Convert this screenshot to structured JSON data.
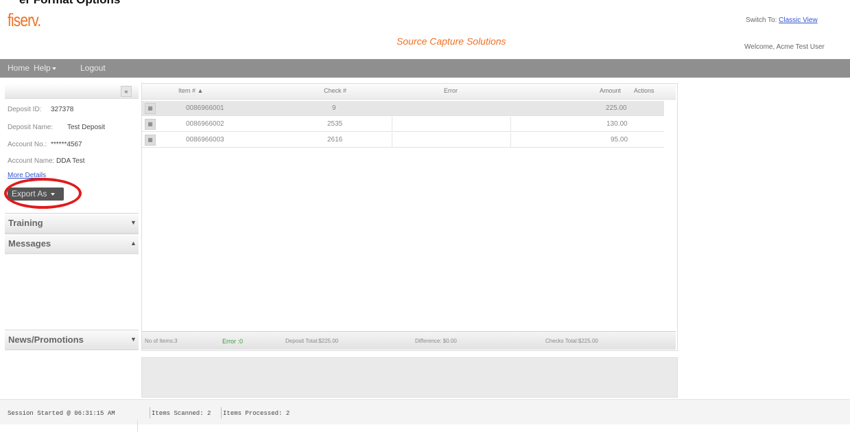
{
  "top_cut_text": "er Format Options",
  "logo": "fiserv.",
  "switch": {
    "prefix": "Switch To:",
    "link": "Classic View"
  },
  "app_title": "Source Capture Solutions",
  "welcome": "Welcome, Acme Test User",
  "menu": {
    "home": "Home",
    "help": "Help",
    "logout": "Logout"
  },
  "deposit": {
    "id_label": "Deposit ID:",
    "id_value": "327378",
    "name_label": "Deposit Name:",
    "name_value": "Test Deposit",
    "acct_label": "Account No.:",
    "acct_value": "******4567",
    "acct_name_label": "Account Name:",
    "acct_name_value": "DDA Test",
    "more": "More Details",
    "export": "Export As"
  },
  "accordions": {
    "training": "Training",
    "messages": "Messages",
    "news": "News/Promotions"
  },
  "grid": {
    "headers": {
      "item": "Item # ▲",
      "check": "Check #",
      "error": "Error",
      "amount": "Amount",
      "actions": "Actions"
    },
    "rows": [
      {
        "item": "0086966001",
        "check": "9",
        "amount": "225.00"
      },
      {
        "item": "0086966002",
        "check": "2535",
        "amount": "130.00"
      },
      {
        "item": "0086966003",
        "check": "2616",
        "amount": "95.00"
      }
    ],
    "footer": {
      "items": "No of Items:3",
      "error": "Error :0",
      "deposit_total": "Deposit Total:$225.00",
      "difference": "Difference: $0.00",
      "checks_total": "Checks Total:$225.00"
    }
  },
  "status": {
    "session": "Session Started @ 06:31:15 AM",
    "scanned": "Items Scanned: 2",
    "processed": "Items Processed: 2"
  },
  "colors": {
    "brand": "#f07022",
    "menubar": "#8f8f8f",
    "highlight": "#e11b1b",
    "link": "#3355cc"
  }
}
